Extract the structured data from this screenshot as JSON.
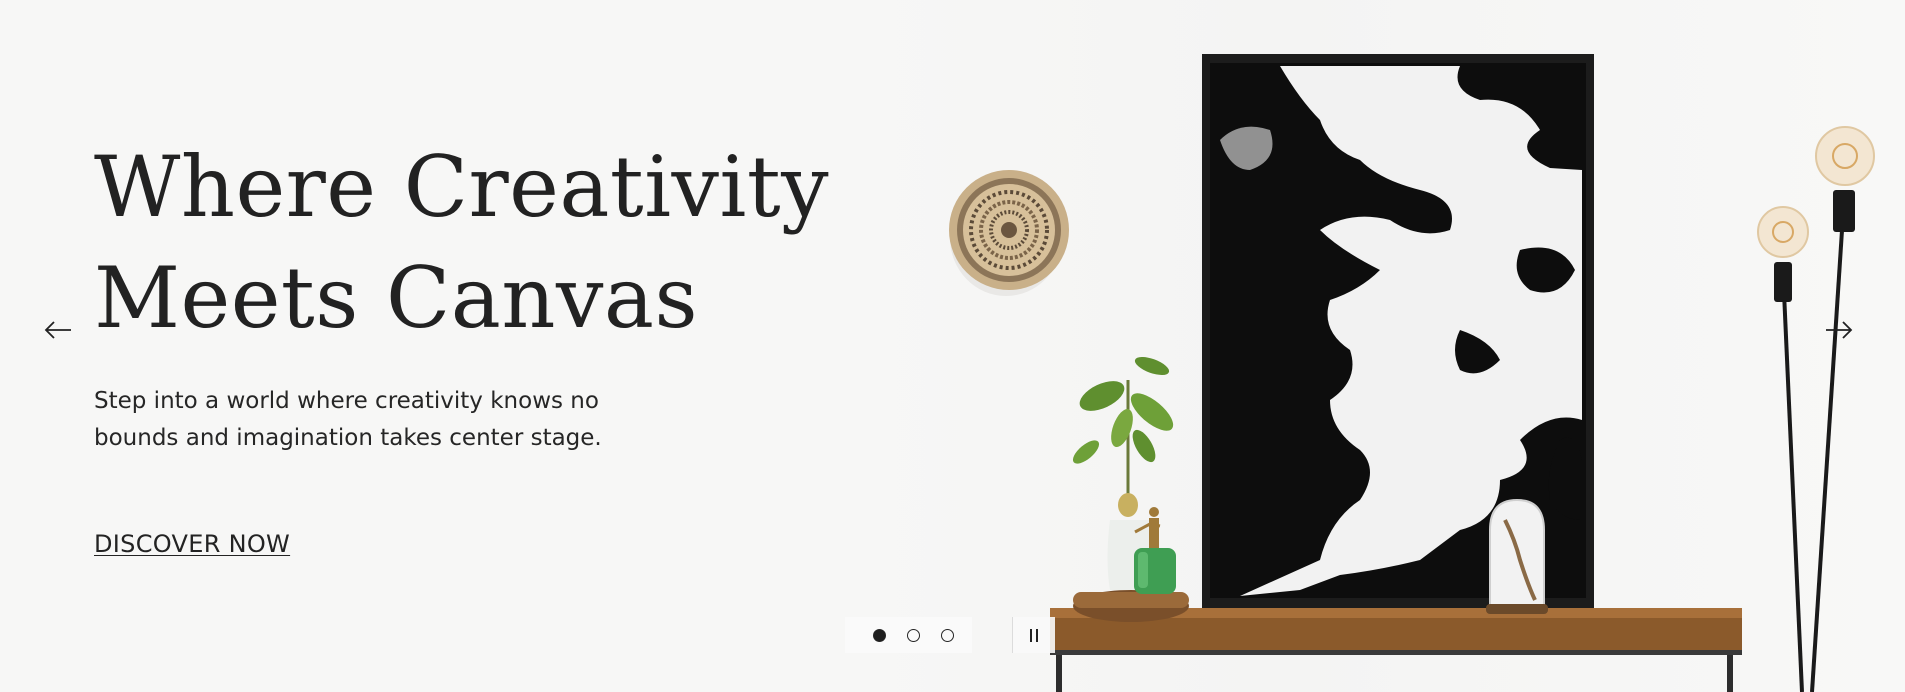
{
  "hero": {
    "title_line_1": "Where Creativity",
    "title_line_2": "Meets Canvas",
    "subtitle_line_1": "Step into a world where creativity knows no",
    "subtitle_line_2": "bounds and imagination takes center stage.",
    "cta_label": "DISCOVER NOW"
  },
  "navigation": {
    "prev_icon": "arrow-left-icon",
    "next_icon": "arrow-right-icon",
    "pause_icon": "pause-icon"
  },
  "slideshow": {
    "slide_count": 3,
    "active_slide": 1
  },
  "colors": {
    "background": "#f7f7f6",
    "text": "#222222",
    "accent": "#1e1e1e"
  }
}
